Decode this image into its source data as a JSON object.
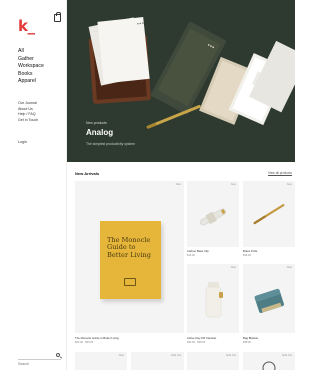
{
  "brand": {
    "logo": "k_",
    "accent": "#e23b3b"
  },
  "nav": {
    "main": [
      "All",
      "Gather",
      "Workspace",
      "Books",
      "Apparel"
    ],
    "secondary": [
      "Our Journal",
      "About Us",
      "Help / FAQ",
      "Get in Touch"
    ],
    "login": "Login"
  },
  "search": {
    "placeholder": "Search"
  },
  "hero": {
    "label": "New products",
    "title": "Analog",
    "subtitle": "The simplest productivity system",
    "bg": "#2e3a30"
  },
  "new_arrivals": {
    "title": "New Arrivals",
    "view_all": "View all products",
    "products": [
      {
        "name": "The Monocle Guide to Better Living",
        "price": "$60.00 · $60.00",
        "tag": "New",
        "book_title": "The Monocle Guide to Better Living"
      },
      {
        "name": "Carbon Bass Clip",
        "price": "$14.00",
        "tag": "New"
      },
      {
        "name": "Brass Knife",
        "price": "$36.00",
        "tag": "New"
      },
      {
        "name": "Active Day Kiff Canister",
        "price": "$32.00 · $38.00",
        "tag": "New"
      },
      {
        "name": "Bag Blanket",
        "price": "$98.00",
        "tag": "New"
      }
    ],
    "row2_tags": [
      "New",
      "Sold Out",
      "Sold Out",
      "Sold Out"
    ]
  }
}
